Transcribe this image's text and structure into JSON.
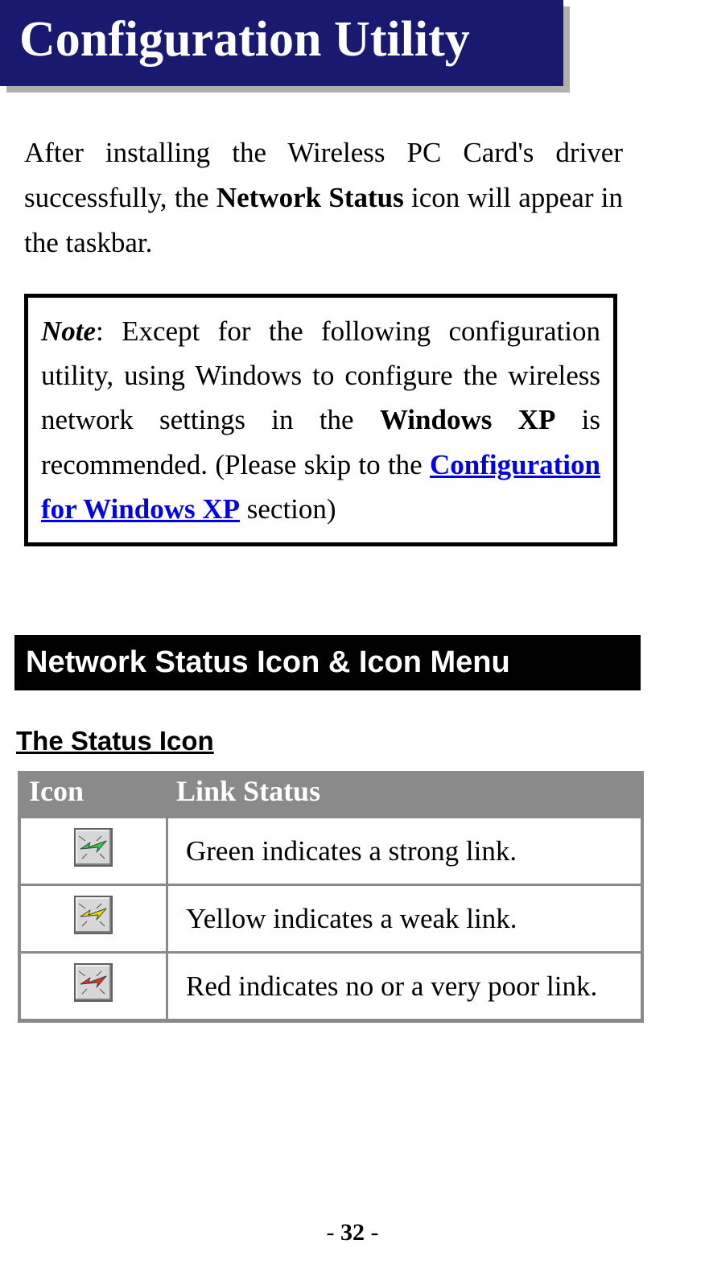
{
  "title": "Configuration Utility",
  "intro": {
    "part1": "After installing the Wireless PC Card's driver successfully, the ",
    "bold1": "Network Status",
    "part2": " icon will appear in the taskbar."
  },
  "note": {
    "label": "Note",
    "part1": ": Except for the following configuration utility, using Windows to configure the wireless network settings in the ",
    "bold1": "Windows XP",
    "part2": " is recommended. (Please skip to the ",
    "link_text": "Configuration for Windows XP",
    "part3": " section)"
  },
  "section_heading": "Network Status Icon & Icon Menu",
  "sub_heading": "The Status Icon",
  "table": {
    "headers": {
      "icon": "Icon",
      "link_status": "Link Status"
    },
    "rows": [
      {
        "icon": "status-green-icon",
        "svg_color": "#2ecc40",
        "desc": "Green indicates a strong link."
      },
      {
        "icon": "status-yellow-icon",
        "svg_color": "#f0e000",
        "desc": "Yellow indicates a weak link."
      },
      {
        "icon": "status-red-icon",
        "svg_color": "#e03020",
        "desc": "Red indicates no or a very poor link."
      }
    ]
  },
  "chart_data": {
    "type": "table",
    "title": "The Status Icon",
    "columns": [
      "Icon",
      "Link Status"
    ],
    "rows": [
      [
        "green",
        "Green indicates a strong link."
      ],
      [
        "yellow",
        "Yellow indicates a weak link."
      ],
      [
        "red",
        "Red indicates no or a very poor link."
      ]
    ]
  },
  "footer": {
    "pre": "- ",
    "page_number": "32",
    "post": " -"
  }
}
